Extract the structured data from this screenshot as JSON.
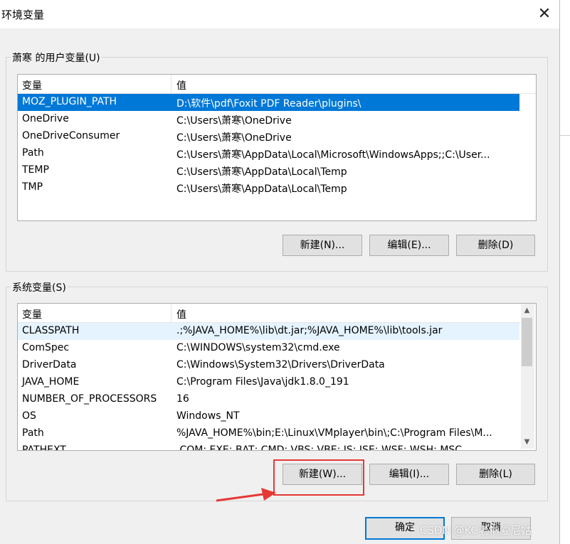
{
  "window": {
    "title": "环境变量",
    "close_glyph": "✕"
  },
  "user_vars": {
    "group_label": "萧寒 的用户变量(U)",
    "headers": {
      "name": "变量",
      "value": "值"
    },
    "rows": [
      {
        "name": "MOZ_PLUGIN_PATH",
        "value": "D:\\软件\\pdf\\Foxit PDF Reader\\plugins\\"
      },
      {
        "name": "OneDrive",
        "value": "C:\\Users\\萧寒\\OneDrive"
      },
      {
        "name": "OneDriveConsumer",
        "value": "C:\\Users\\萧寒\\OneDrive"
      },
      {
        "name": "Path",
        "value": "C:\\Users\\萧寒\\AppData\\Local\\Microsoft\\WindowsApps;;C:\\User..."
      },
      {
        "name": "TEMP",
        "value": "C:\\Users\\萧寒\\AppData\\Local\\Temp"
      },
      {
        "name": "TMP",
        "value": "C:\\Users\\萧寒\\AppData\\Local\\Temp"
      }
    ],
    "selected_row": "MOZ_PLUGIN_PATH",
    "buttons": {
      "new": "新建(N)...",
      "edit": "编辑(E)...",
      "delete": "删除(D)"
    }
  },
  "system_vars": {
    "group_label": "系统变量(S)",
    "headers": {
      "name": "变量",
      "value": "值"
    },
    "rows": [
      {
        "name": "CLASSPATH",
        "value": ".;%JAVA_HOME%\\lib\\dt.jar;%JAVA_HOME%\\lib\\tools.jar"
      },
      {
        "name": "ComSpec",
        "value": "C:\\WINDOWS\\system32\\cmd.exe"
      },
      {
        "name": "DriverData",
        "value": "C:\\Windows\\System32\\Drivers\\DriverData"
      },
      {
        "name": "JAVA_HOME",
        "value": "C:\\Program Files\\Java\\jdk1.8.0_191"
      },
      {
        "name": "NUMBER_OF_PROCESSORS",
        "value": "16"
      },
      {
        "name": "OS",
        "value": "Windows_NT"
      },
      {
        "name": "Path",
        "value": "%JAVA_HOME%\\bin;E:\\Linux\\VMplayer\\bin\\;C:\\Program Files\\M..."
      },
      {
        "name": "PATHEXT",
        "value": ".COM;.EXE;.BAT;.CMD;.VBS;.VBE;.JS;.JSE;.WSF;.WSH;.MSC"
      }
    ],
    "hover_row": "CLASSPATH",
    "buttons": {
      "new": "新建(W)...",
      "edit": "编辑(I)...",
      "delete": "删除(L)"
    },
    "scroll_up": "▲",
    "scroll_down": "▼"
  },
  "footer": {
    "ok": "确定",
    "cancel": "取消"
  },
  "annotation": {
    "highlight_color": "#e53935"
  },
  "watermark": "CSDN @KC老衲爱尼姑"
}
